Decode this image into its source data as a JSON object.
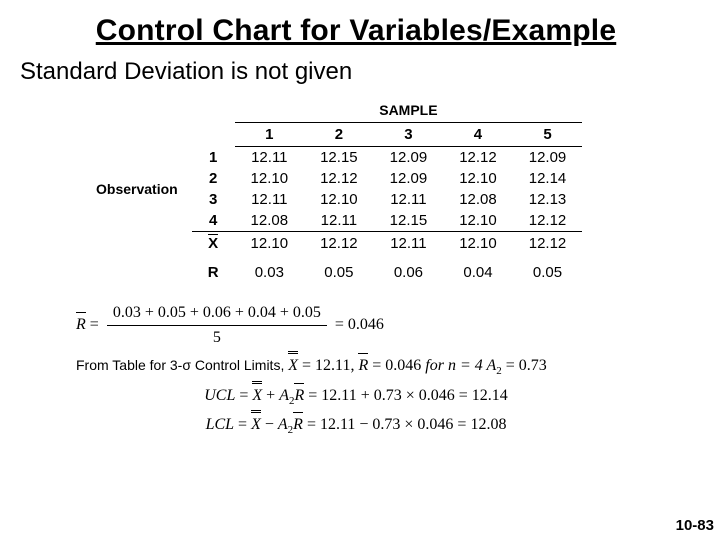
{
  "title": "Control Chart for Variables/Example",
  "subtitle": "Standard Deviation is not given",
  "sample_label": "SAMPLE",
  "observation_label": "Observation",
  "sample_headers": [
    "1",
    "2",
    "3",
    "4",
    "5"
  ],
  "observation_labels": [
    "1",
    "2",
    "3",
    "4"
  ],
  "xbar_label": "X̄",
  "r_label": "R",
  "chart_data": {
    "type": "table",
    "title": "Sample observations",
    "row_labels": [
      "1",
      "2",
      "3",
      "4",
      "X̄",
      "R"
    ],
    "col_labels": [
      "1",
      "2",
      "3",
      "4",
      "5"
    ],
    "rows": [
      [
        "12.11",
        "12.15",
        "12.09",
        "12.12",
        "12.09"
      ],
      [
        "12.10",
        "12.12",
        "12.09",
        "12.10",
        "12.14"
      ],
      [
        "12.11",
        "12.10",
        "12.11",
        "12.08",
        "12.13"
      ],
      [
        "12.08",
        "12.11",
        "12.15",
        "12.10",
        "12.12"
      ],
      [
        "12.10",
        "12.12",
        "12.11",
        "12.10",
        "12.12"
      ],
      [
        "0.03",
        "0.05",
        "0.06",
        "0.04",
        "0.05"
      ]
    ]
  },
  "eq": {
    "rbar_lhs": "R̄ =",
    "rbar_num": "0.03 + 0.05 + 0.06 + 0.04 + 0.05",
    "rbar_den": "5",
    "rbar_res": "= 0.046",
    "table_line_prefix": "From Table for 3-σ Control Limits, ",
    "xbarbar": "X̄̄ = 12.11,",
    "rbar_val": "R̄ = 0.046",
    "for_n": " for n = 4 ",
    "a2": "A",
    "a2_sub": "2",
    "a2_val": " = 0.73",
    "ucl_lhs": "UCL = X̄̄ + A",
    "ucl_sub": "2",
    "ucl_mid": "R̄ = 12.11 + 0.73 × 0.046 = 12.14",
    "lcl_lhs": "LCL = X̄̄ − A",
    "lcl_sub": "2",
    "lcl_mid": "R̄ = 12.11 − 0.73 × 0.046 = 12.08"
  },
  "page_number": "10-83"
}
